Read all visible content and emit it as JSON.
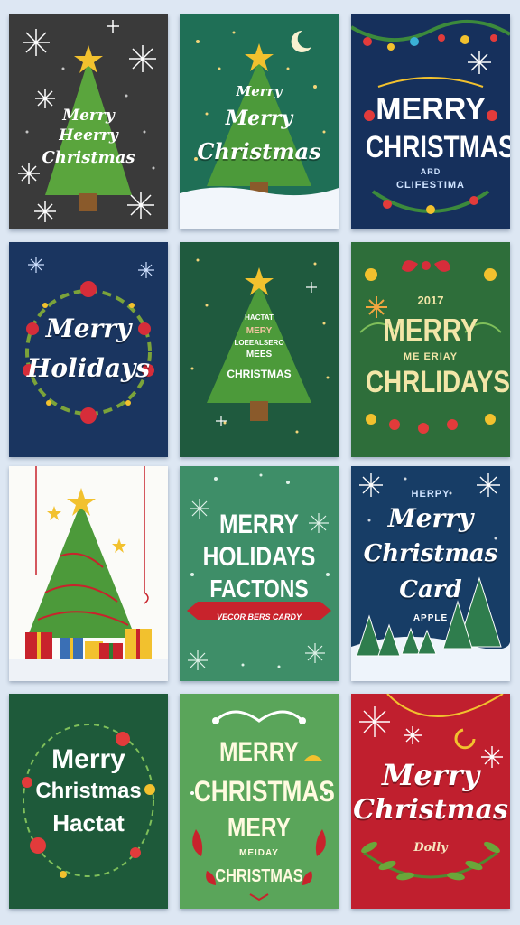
{
  "colors": {
    "page_bg": "#dde7f3",
    "card1_bg": "#3a3a3a",
    "card2_bg": "#1f6f56",
    "card3_bg": "#16305c",
    "card4_bg": "#1a3560",
    "card5_bg": "#1f5a3e",
    "card6_bg": "#2e6e3a",
    "card7_bg": "#fbfbf8",
    "card8_bg": "#3e8e68",
    "card9_bg": "#173d66",
    "card10_bg": "#1e5a3a",
    "card11_bg": "#5aa55a",
    "card12_bg": "#c01f2e",
    "tree_green": "#4c9a3a",
    "star_gold": "#f2c12e",
    "ribbon_red": "#c8232c"
  },
  "cards": [
    {
      "lines": [
        "Merry",
        "Heerry",
        "Christmas"
      ]
    },
    {
      "lines": [
        "Merry",
        "Merry",
        "Christmas"
      ]
    },
    {
      "lines": [
        "MERRY",
        "CHRISTMAS",
        "ARD",
        "CLIFESTIMA"
      ]
    },
    {
      "lines": [
        "Merry",
        "Holidays"
      ]
    },
    {
      "lines": [
        "HACTAT",
        "MERY",
        "LOEEALSERO",
        "MEES",
        "CHRISTMAS"
      ]
    },
    {
      "lines": [
        "2017",
        "MERRY",
        "ME ERIAY",
        "CHRLIDAYS"
      ]
    },
    {
      "lines": []
    },
    {
      "lines": [
        "MERRY",
        "HOLIDAYS",
        "FACTONS",
        "VECOR BERS CARDY"
      ]
    },
    {
      "lines": [
        "HERPY",
        "Merry",
        "Christmas",
        "Card",
        "APPLE"
      ]
    },
    {
      "lines": [
        "Merry",
        "Christmas",
        "Hactat"
      ]
    },
    {
      "lines": [
        "MERRY",
        "CHRISTMAS",
        "MERY",
        "MEIDAY",
        "CHRISTMAS"
      ]
    },
    {
      "lines": [
        "Merry",
        "Christmas",
        "Dolly"
      ]
    }
  ]
}
